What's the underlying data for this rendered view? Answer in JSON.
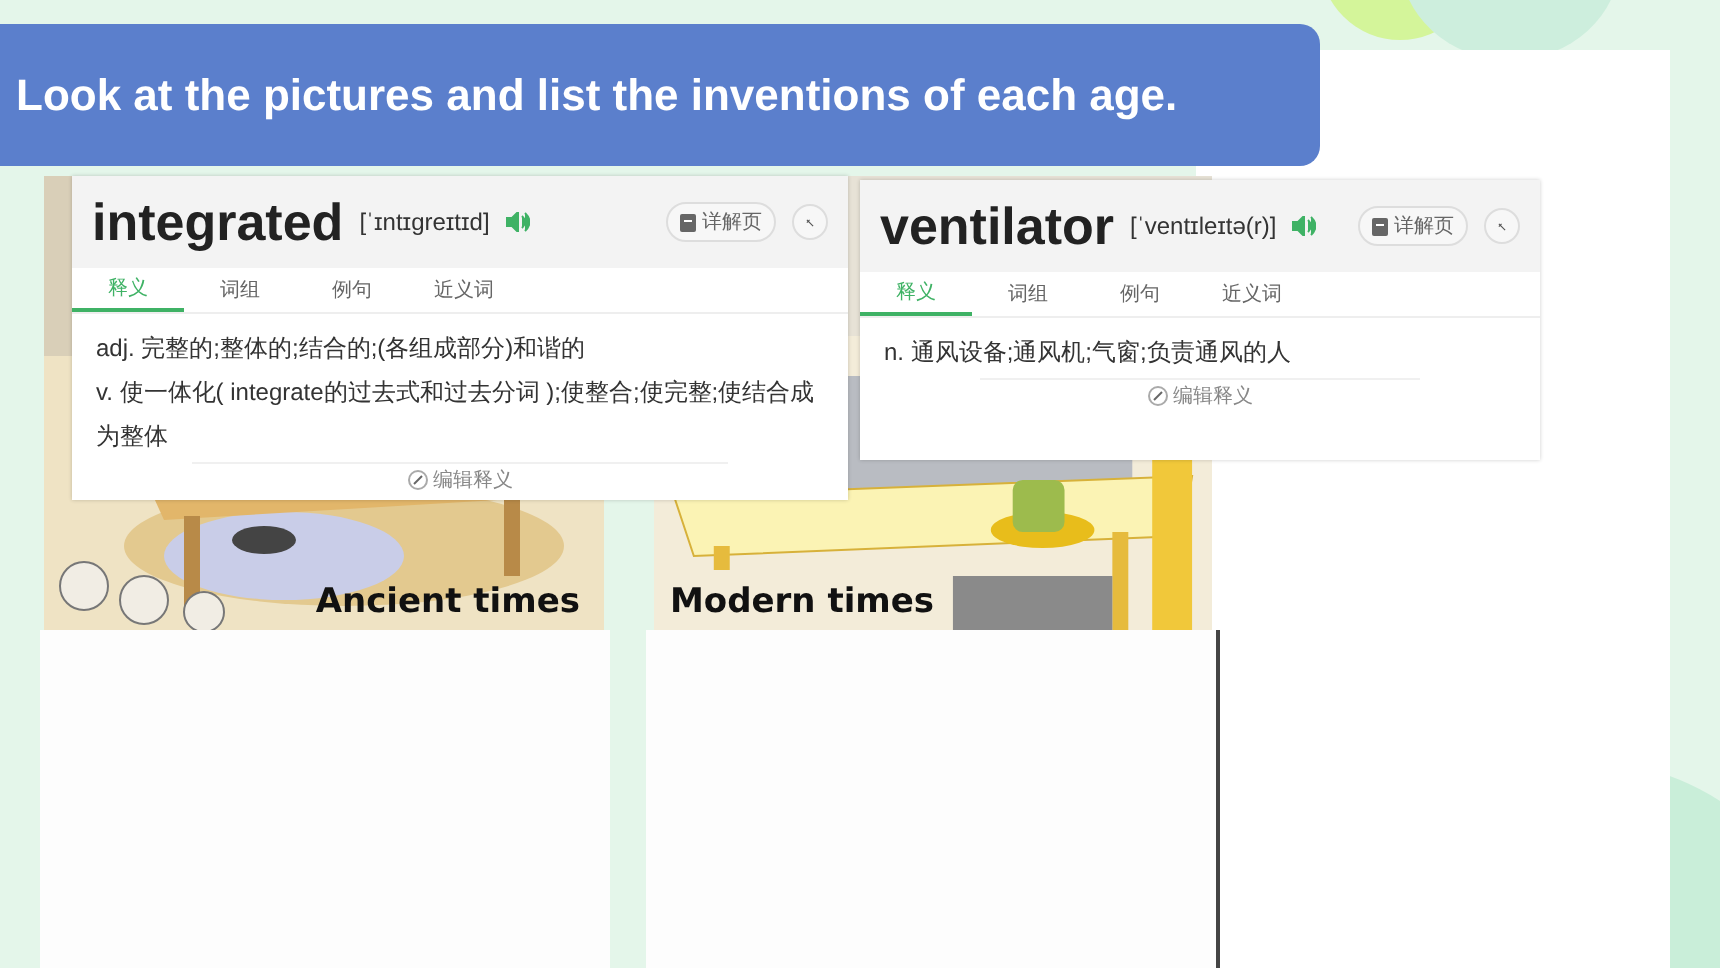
{
  "slide": {
    "title": "Look at the pictures and list the inventions of each age.",
    "pictures": [
      {
        "kind": "ancient",
        "caption": "Ancient times"
      },
      {
        "kind": "modern",
        "caption": "Modern times"
      }
    ]
  },
  "dictionary_popups": [
    {
      "word": "integrated",
      "phonetic": "[ˈɪntɪɡreɪtɪd]",
      "detail_button": "详解页",
      "tabs": [
        {
          "label": "释义",
          "selected": true
        },
        {
          "label": "词组",
          "selected": false
        },
        {
          "label": "例句",
          "selected": false
        },
        {
          "label": "近义词",
          "selected": false
        }
      ],
      "definitions": [
        {
          "pos": "adj.",
          "text": "完整的;整体的;结合的;(各组成部分)和谐的"
        },
        {
          "pos": "v.",
          "text": "使一体化( integrate的过去式和过去分词 );使整合;使完整;使结合成为整体"
        }
      ],
      "footer": "编辑释义"
    },
    {
      "word": "ventilator",
      "phonetic": "[ˈventɪleɪtə(r)]",
      "detail_button": "详解页",
      "tabs": [
        {
          "label": "释义",
          "selected": true
        },
        {
          "label": "词组",
          "selected": false
        },
        {
          "label": "例句",
          "selected": false
        },
        {
          "label": "近义词",
          "selected": false
        }
      ],
      "definitions": [
        {
          "pos": "n.",
          "text": "通风设备;通风机;气窗;负责通风的人"
        }
      ],
      "footer": "编辑释义"
    }
  ]
}
